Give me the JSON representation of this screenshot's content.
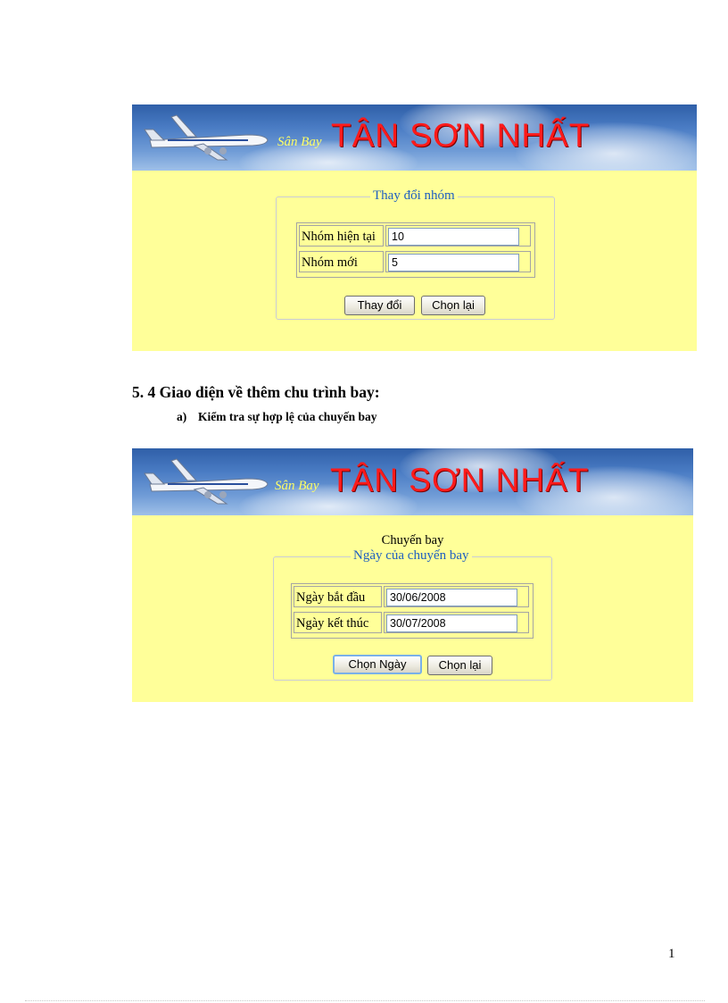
{
  "banner": {
    "subtitle": "Sân Bay",
    "title": "TÂN SƠN NHẤT"
  },
  "screen1": {
    "legend": "Thay đổi nhóm",
    "fields": [
      {
        "label": "Nhóm hiện tại",
        "value": "10"
      },
      {
        "label": "Nhóm mới",
        "value": "5"
      }
    ],
    "buttons": {
      "submit": "Thay đổi",
      "reset": "Chọn lại"
    }
  },
  "section": {
    "heading": "5. 4 Giao diện về thêm chu trình bay:",
    "sub_marker": "a)",
    "sub_text": "Kiểm tra sự hợp lệ của chuyến bay"
  },
  "screen2": {
    "caption": "Chuyến bay",
    "legend": "Ngày của chuyến bay",
    "fields": [
      {
        "label": "Ngày bắt đầu",
        "value": "30/06/2008"
      },
      {
        "label": "Ngày kết thúc",
        "value": "30/07/2008"
      }
    ],
    "buttons": {
      "submit": "Chọn Ngày",
      "reset": "Chọn lại"
    }
  },
  "page_number": "1"
}
